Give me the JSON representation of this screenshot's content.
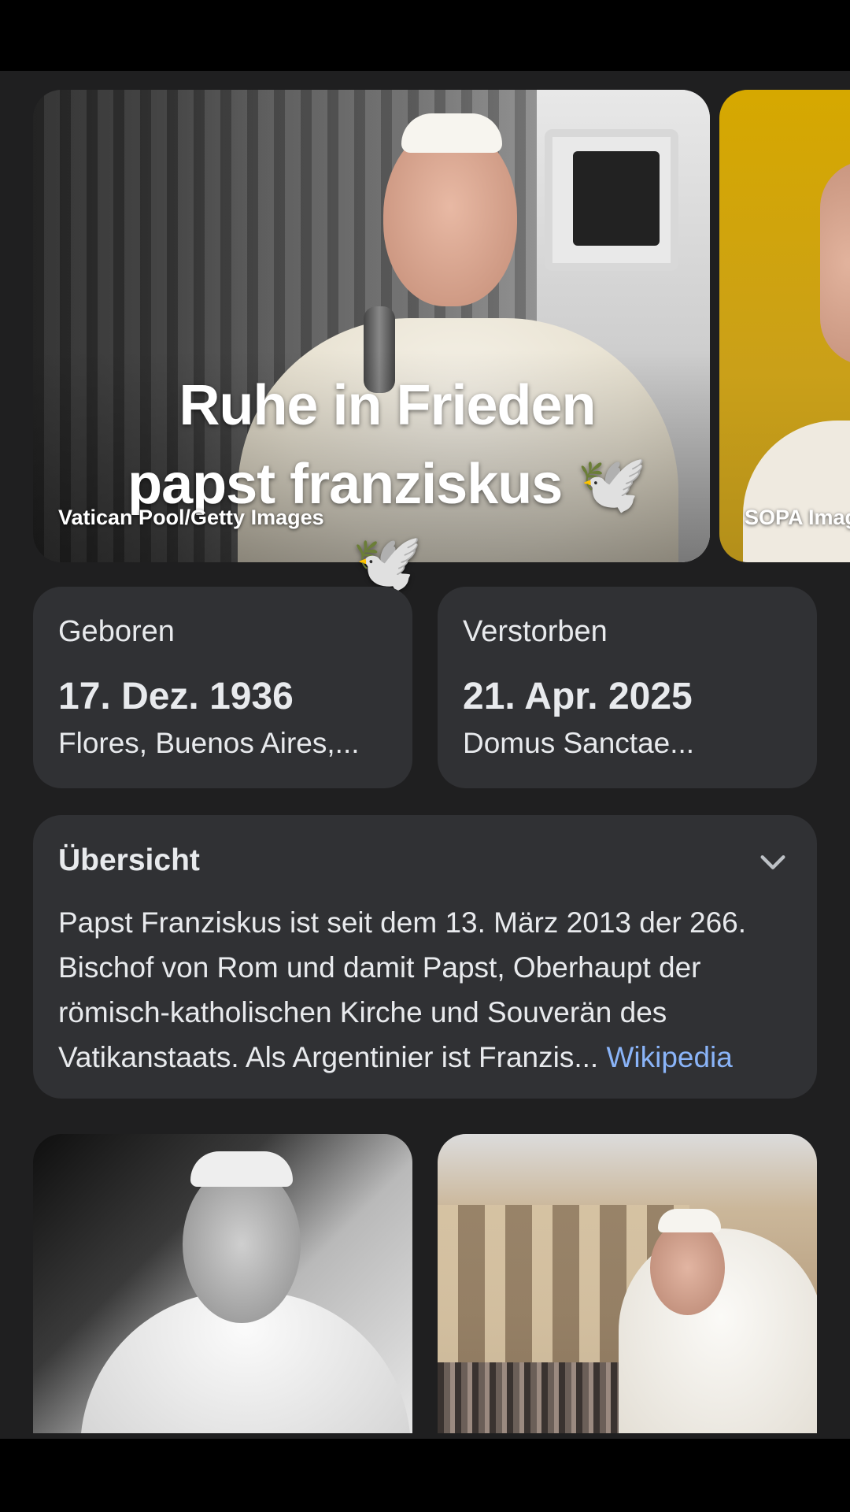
{
  "hero": {
    "title": "Ruhe in Frieden papst franziskus 🕊️🕊️",
    "credit": "Vatican Pool/Getty Images",
    "second_credit": "SOPA Imag"
  },
  "facts": [
    {
      "label": "Geboren",
      "value": "17. Dez. 1936",
      "sub": "Flores, Buenos Aires,..."
    },
    {
      "label": "Verstorben",
      "value": "21. Apr. 2025",
      "sub": "Domus Sanctae..."
    }
  ],
  "overview": {
    "title": "Übersicht",
    "text": "Papst Franziskus ist seit dem 13. März 2013 der 266. Bischof von Rom und damit Papst, Oberhaupt der römisch-katholischen Kirche und Souverän des Vatikanstaats. Als Argentinier ist Franzis...",
    "link": "Wikipedia",
    "chevron_icon": "chevron-down-icon"
  },
  "colors": {
    "background": "#1f1f20",
    "card": "#303134",
    "text": "#e8eaed",
    "link": "#8ab4f8"
  }
}
